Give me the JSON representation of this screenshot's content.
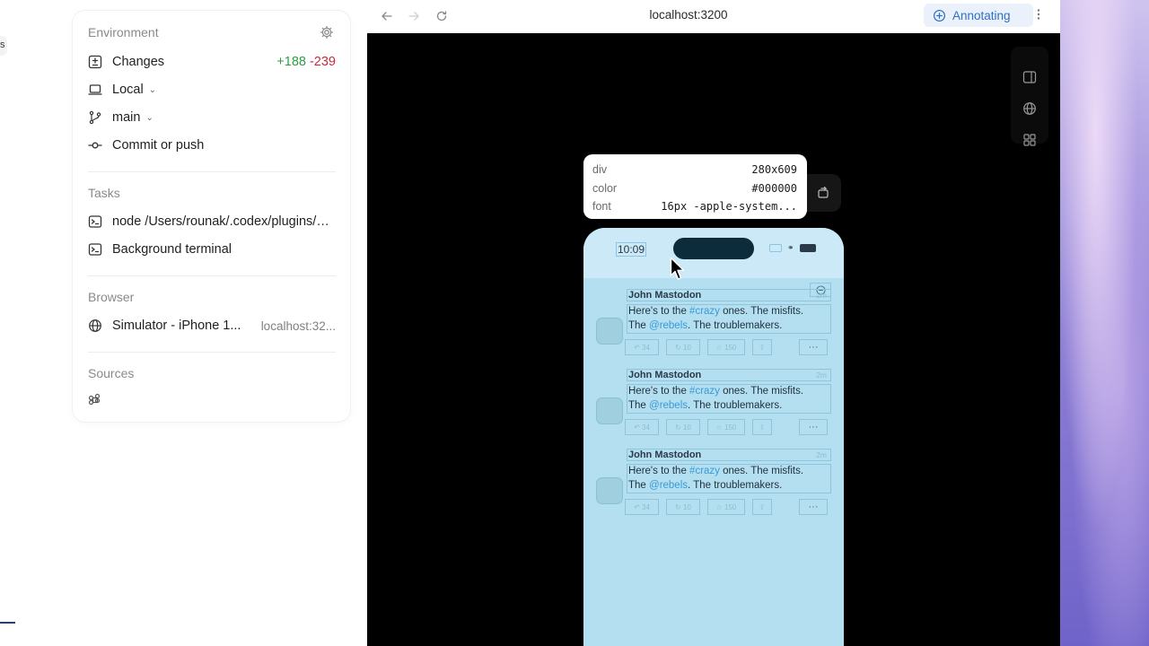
{
  "left_panel": {
    "edge_label": "s",
    "environment": {
      "title": "Environment",
      "changes_label": "Changes",
      "changes_added": "+188",
      "changes_removed": "-239",
      "location_label": "Local",
      "branch_label": "main",
      "commit_label": "Commit or push"
    },
    "tasks": {
      "title": "Tasks",
      "items": [
        {
          "label": "node /Users/rounak/.codex/plugins/ca..."
        },
        {
          "label": "Background terminal"
        }
      ]
    },
    "browser": {
      "title": "Browser",
      "items": [
        {
          "label": "Simulator - iPhone 1...",
          "url": "localhost:32..."
        }
      ]
    },
    "sources": {
      "title": "Sources"
    }
  },
  "topbar": {
    "url": "localhost:3200",
    "annotate_label": "Annotating"
  },
  "tooltip": {
    "rows": [
      {
        "key": "div",
        "value": "280x609"
      },
      {
        "key": "color",
        "value": "#000000"
      },
      {
        "key": "font",
        "value": "16px -apple-system..."
      }
    ]
  },
  "phone": {
    "time": "10:09",
    "posts": [
      {
        "name": "John Mastodon",
        "time": "2m",
        "line1_pre": "Here's to the ",
        "line1_tag": "#crazy",
        "line1_post": " ones. The misfits.",
        "line2_pre": "The ",
        "line2_tag": "@rebels",
        "line2_post": ". The troublemakers.",
        "replies": "34",
        "boosts": "10",
        "favs": "150",
        "more": "···"
      },
      {
        "name": "John Mastodon",
        "time": "2m",
        "line1_pre": "Here's to the ",
        "line1_tag": "#crazy",
        "line1_post": " ones. The misfits.",
        "line2_pre": "The ",
        "line2_tag": "@rebels",
        "line2_post": ". The troublemakers.",
        "replies": "34",
        "boosts": "10",
        "favs": "150",
        "more": "···"
      },
      {
        "name": "John Mastodon",
        "time": "2m",
        "line1_pre": "Here's to the ",
        "line1_tag": "#crazy",
        "line1_post": " ones. The misfits.",
        "line2_pre": "The ",
        "line2_tag": "@rebels",
        "line2_post": ". The troublemakers.",
        "replies": "34",
        "boosts": "10",
        "favs": "150",
        "more": "···"
      }
    ]
  },
  "icons": {
    "settings": "gear-icon",
    "changes": "diff-icon",
    "local": "laptop-icon",
    "branch": "git-branch-icon",
    "commit": "git-commit-icon",
    "terminal": "terminal-icon",
    "globe": "globe-icon",
    "sources": "command-icon",
    "back": "arrow-left-icon",
    "forward": "arrow-right-icon",
    "reload": "reload-icon",
    "annotate": "plus-circle-icon",
    "more": "kebab-icon",
    "panel": "sidebar-panel-icon",
    "grid": "grid-icon",
    "rotate": "rotate-icon"
  },
  "colors": {
    "accent": "#2f6fc4",
    "added": "#2f9e44",
    "removed": "#c92a3a",
    "highlight": "#b5e0f0"
  }
}
